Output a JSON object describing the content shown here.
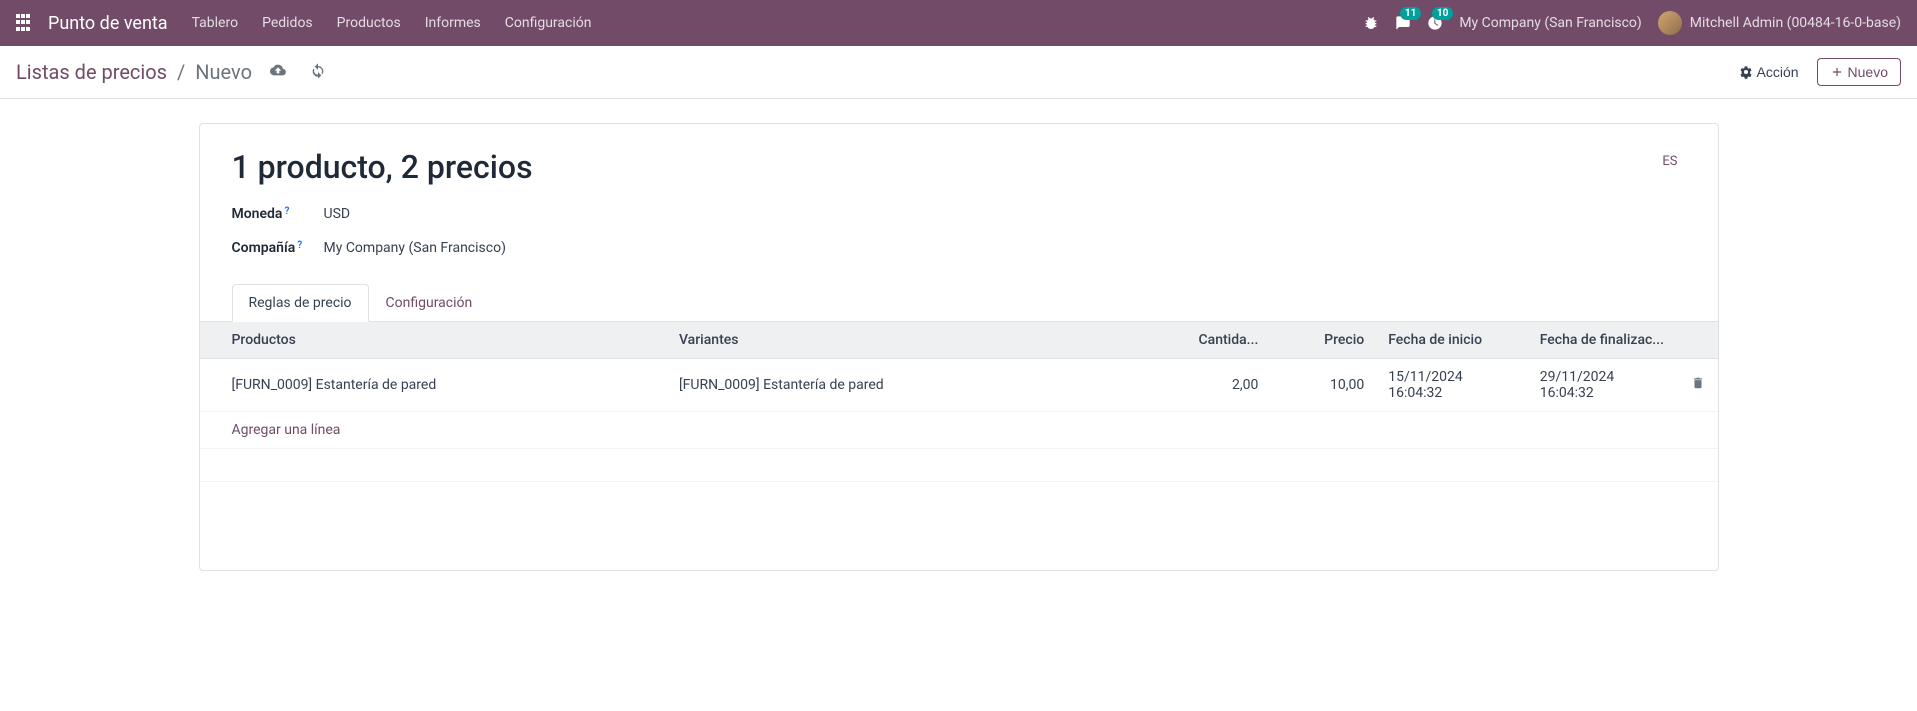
{
  "navbar": {
    "brand": "Punto de venta",
    "menu": [
      "Tablero",
      "Pedidos",
      "Productos",
      "Informes",
      "Configuración"
    ],
    "messages_badge": "11",
    "activities_badge": "10",
    "company": "My Company (San Francisco)",
    "user": "Mitchell Admin (00484-16-0-base)"
  },
  "breadcrumb": {
    "parent": "Listas de precios",
    "separator": "/",
    "current": "Nuevo"
  },
  "actions": {
    "action_label": "Acción",
    "new_label": "Nuevo"
  },
  "form": {
    "title": "1 producto, 2 precios",
    "lang": "ES",
    "currency_label": "Moneda",
    "currency_value": "USD",
    "company_label": "Compañía",
    "company_value": "My Company (San Francisco)",
    "help": "?"
  },
  "tabs": {
    "rules": "Reglas de precio",
    "config": "Configuración"
  },
  "table": {
    "headers": {
      "product": "Productos",
      "variant": "Variantes",
      "qty": "Cantida...",
      "price": "Precio",
      "start": "Fecha de inicio",
      "end": "Fecha de finalizac..."
    },
    "rows": [
      {
        "product": "[FURN_0009] Estantería de pared",
        "variant": "[FURN_0009] Estantería de pared",
        "qty": "2,00",
        "price": "10,00",
        "start": "15/11/2024 16:04:32",
        "end": "29/11/2024 16:04:32"
      }
    ],
    "add_line": "Agregar una línea"
  }
}
